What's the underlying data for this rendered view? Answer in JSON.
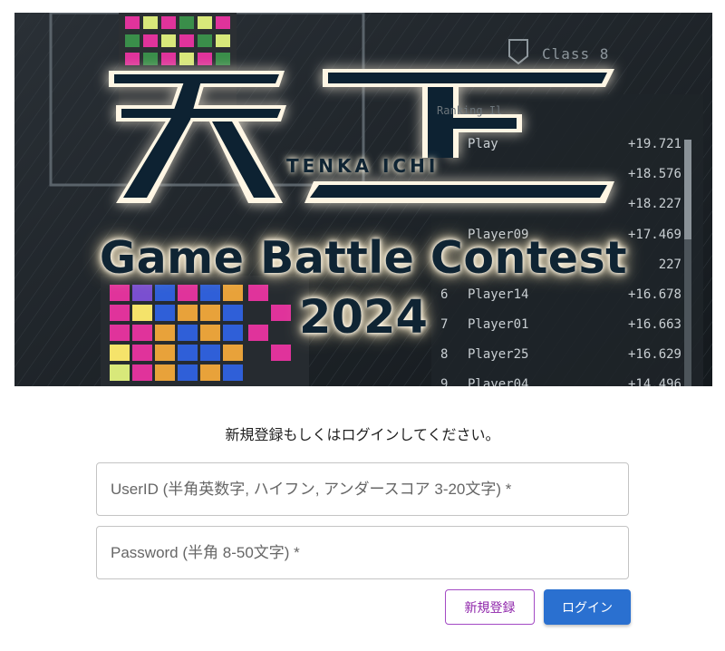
{
  "hero": {
    "class_label": "Class 8",
    "ranking_label": "Ranking Il",
    "title_romaji": "TENKA ICHI",
    "title_en": "Game Battle Contest",
    "year": "2024",
    "ranking": [
      {
        "num": "",
        "player": "Play",
        "score": "+19.721"
      },
      {
        "num": "",
        "player": "",
        "score": "+18.576"
      },
      {
        "num": "",
        "player": "",
        "score": "+18.227"
      },
      {
        "num": "",
        "player": "Player09",
        "score": "+17.469"
      },
      {
        "num": "",
        "player": "",
        "score": "227"
      },
      {
        "num": "6",
        "player": "Player14",
        "score": "+16.678"
      },
      {
        "num": "7",
        "player": "Player01",
        "score": "+16.663"
      },
      {
        "num": "8",
        "player": "Player25",
        "score": "+16.629"
      },
      {
        "num": "9",
        "player": "Player04",
        "score": "+14.496"
      }
    ]
  },
  "form": {
    "prompt": "新規登録もしくはログインしてください。",
    "userid_placeholder": "UserID (半角英数字, ハイフン, アンダースコア 3-20文字) *",
    "password_placeholder": "Password (半角 8-50文字) *",
    "register_label": "新規登録",
    "login_label": "ログイン"
  },
  "colors": {
    "register_accent": "#8e24aa",
    "login_bg": "#2a70d0"
  }
}
